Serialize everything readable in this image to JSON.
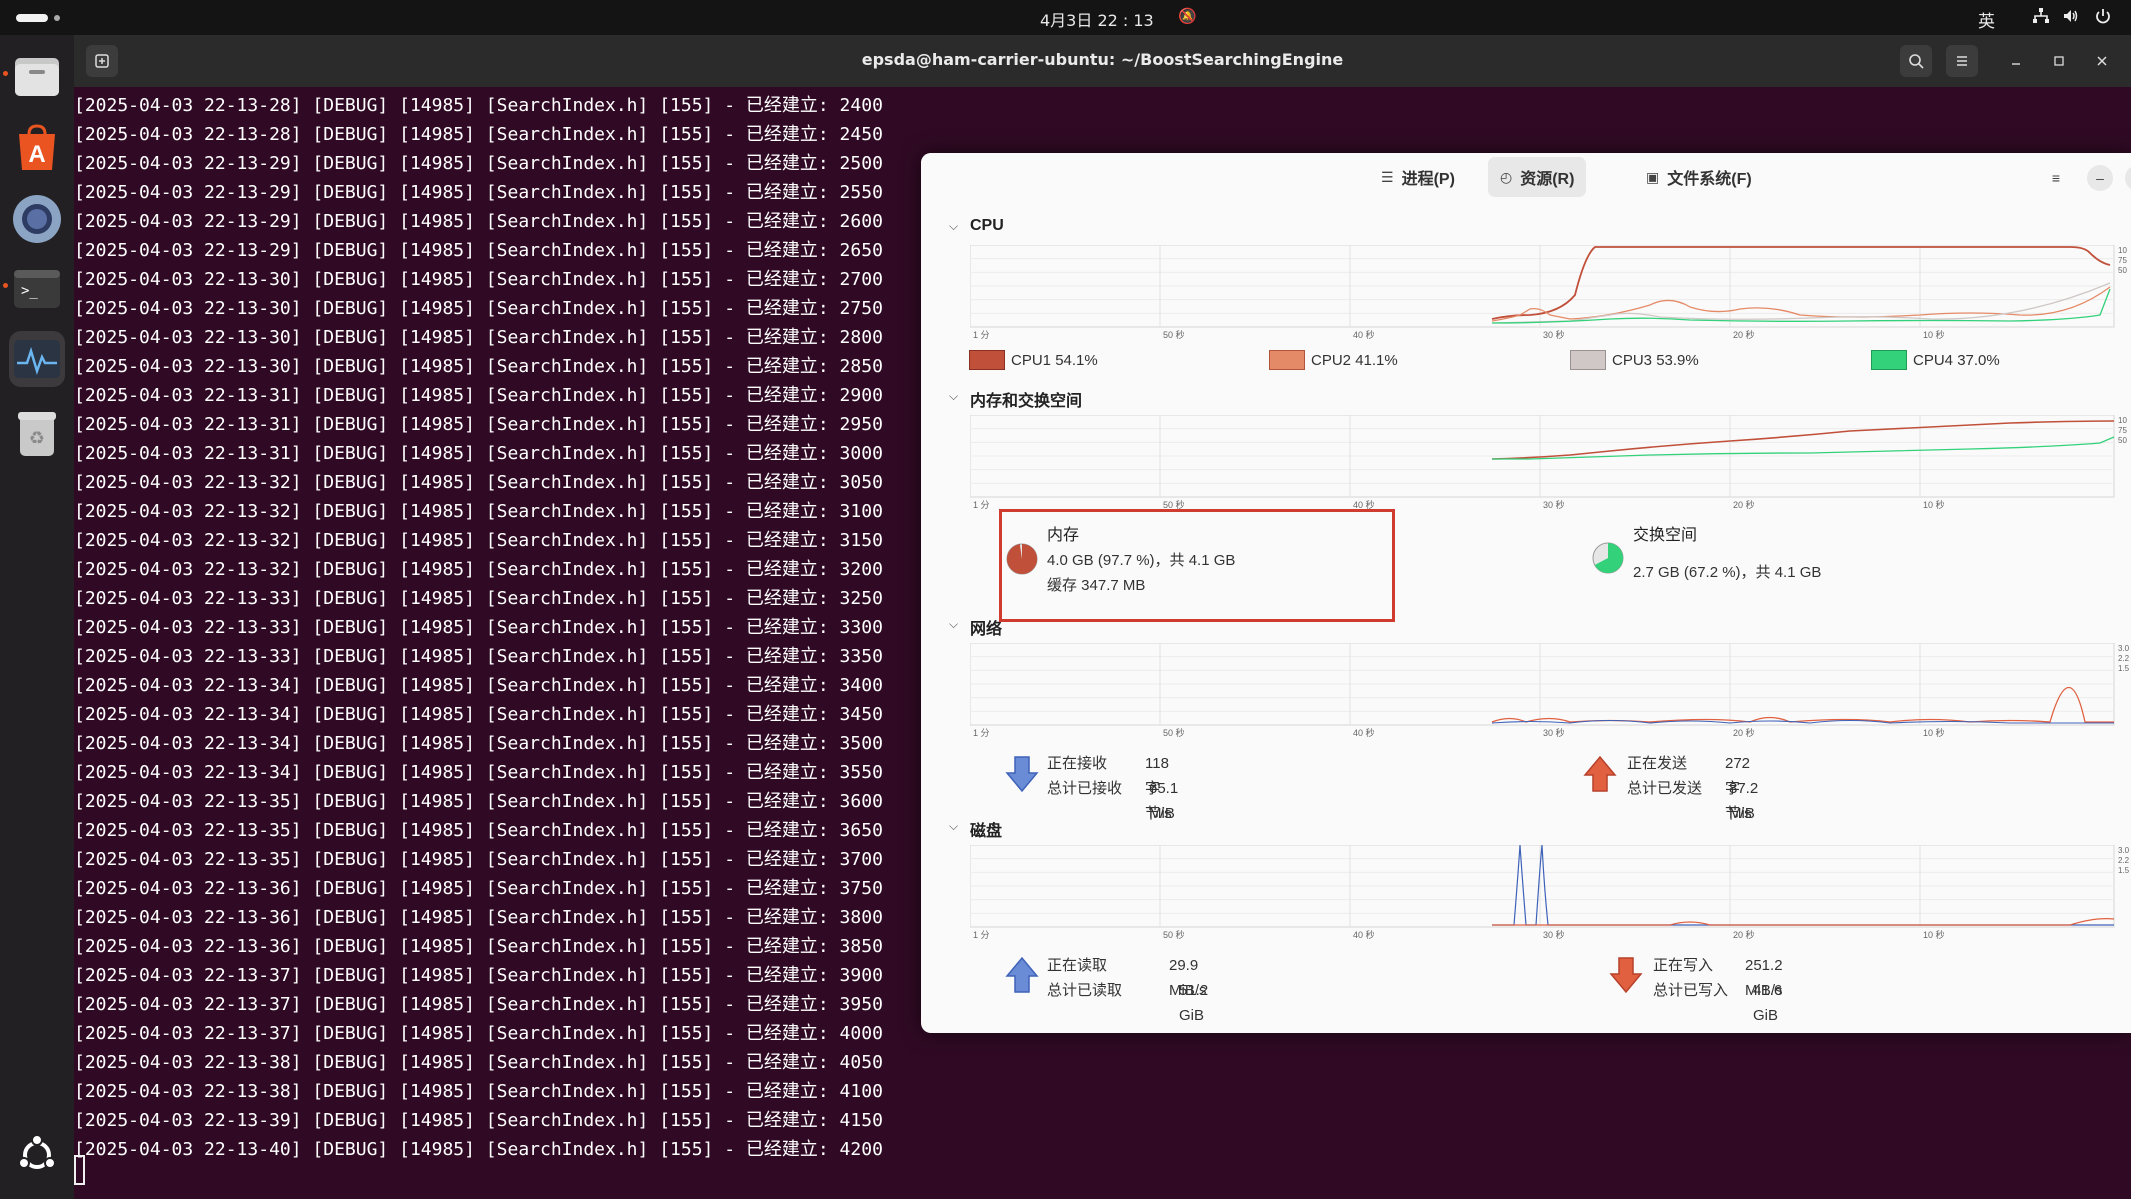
{
  "topbar": {
    "clock": "4月3日  22 : 13",
    "ime": "英"
  },
  "dock": {
    "items": [
      {
        "name": "files-icon"
      },
      {
        "name": "app-center-icon"
      },
      {
        "name": "chromium-icon"
      },
      {
        "name": "terminal-icon"
      },
      {
        "name": "system-monitor-icon"
      },
      {
        "name": "trash-icon"
      }
    ],
    "apps_icon": "ubuntu-apps-icon"
  },
  "terminal": {
    "title": "epsda@ham-carrier-ubuntu: ~/BoostSearchingEngine",
    "lines": [
      "[2025-04-03 22-13-28] [DEBUG] [14985] [SearchIndex.h] [155] - 已经建立: 2400",
      "[2025-04-03 22-13-28] [DEBUG] [14985] [SearchIndex.h] [155] - 已经建立: 2450",
      "[2025-04-03 22-13-29] [DEBUG] [14985] [SearchIndex.h] [155] - 已经建立: 2500",
      "[2025-04-03 22-13-29] [DEBUG] [14985] [SearchIndex.h] [155] - 已经建立: 2550",
      "[2025-04-03 22-13-29] [DEBUG] [14985] [SearchIndex.h] [155] - 已经建立: 2600",
      "[2025-04-03 22-13-29] [DEBUG] [14985] [SearchIndex.h] [155] - 已经建立: 2650",
      "[2025-04-03 22-13-30] [DEBUG] [14985] [SearchIndex.h] [155] - 已经建立: 2700",
      "[2025-04-03 22-13-30] [DEBUG] [14985] [SearchIndex.h] [155] - 已经建立: 2750",
      "[2025-04-03 22-13-30] [DEBUG] [14985] [SearchIndex.h] [155] - 已经建立: 2800",
      "[2025-04-03 22-13-30] [DEBUG] [14985] [SearchIndex.h] [155] - 已经建立: 2850",
      "[2025-04-03 22-13-31] [DEBUG] [14985] [SearchIndex.h] [155] - 已经建立: 2900",
      "[2025-04-03 22-13-31] [DEBUG] [14985] [SearchIndex.h] [155] - 已经建立: 2950",
      "[2025-04-03 22-13-31] [DEBUG] [14985] [SearchIndex.h] [155] - 已经建立: 3000",
      "[2025-04-03 22-13-32] [DEBUG] [14985] [SearchIndex.h] [155] - 已经建立: 3050",
      "[2025-04-03 22-13-32] [DEBUG] [14985] [SearchIndex.h] [155] - 已经建立: 3100",
      "[2025-04-03 22-13-32] [DEBUG] [14985] [SearchIndex.h] [155] - 已经建立: 3150",
      "[2025-04-03 22-13-32] [DEBUG] [14985] [SearchIndex.h] [155] - 已经建立: 3200",
      "[2025-04-03 22-13-33] [DEBUG] [14985] [SearchIndex.h] [155] - 已经建立: 3250",
      "[2025-04-03 22-13-33] [DEBUG] [14985] [SearchIndex.h] [155] - 已经建立: 3300",
      "[2025-04-03 22-13-33] [DEBUG] [14985] [SearchIndex.h] [155] - 已经建立: 3350",
      "[2025-04-03 22-13-34] [DEBUG] [14985] [SearchIndex.h] [155] - 已经建立: 3400",
      "[2025-04-03 22-13-34] [DEBUG] [14985] [SearchIndex.h] [155] - 已经建立: 3450",
      "[2025-04-03 22-13-34] [DEBUG] [14985] [SearchIndex.h] [155] - 已经建立: 3500",
      "[2025-04-03 22-13-34] [DEBUG] [14985] [SearchIndex.h] [155] - 已经建立: 3550",
      "[2025-04-03 22-13-35] [DEBUG] [14985] [SearchIndex.h] [155] - 已经建立: 3600",
      "[2025-04-03 22-13-35] [DEBUG] [14985] [SearchIndex.h] [155] - 已经建立: 3650",
      "[2025-04-03 22-13-35] [DEBUG] [14985] [SearchIndex.h] [155] - 已经建立: 3700",
      "[2025-04-03 22-13-36] [DEBUG] [14985] [SearchIndex.h] [155] - 已经建立: 3750",
      "[2025-04-03 22-13-36] [DEBUG] [14985] [SearchIndex.h] [155] - 已经建立: 3800",
      "[2025-04-03 22-13-36] [DEBUG] [14985] [SearchIndex.h] [155] - 已经建立: 3850",
      "[2025-04-03 22-13-37] [DEBUG] [14985] [SearchIndex.h] [155] - 已经建立: 3900",
      "[2025-04-03 22-13-37] [DEBUG] [14985] [SearchIndex.h] [155] - 已经建立: 3950",
      "[2025-04-03 22-13-37] [DEBUG] [14985] [SearchIndex.h] [155] - 已经建立: 4000",
      "[2025-04-03 22-13-38] [DEBUG] [14985] [SearchIndex.h] [155] - 已经建立: 4050",
      "[2025-04-03 22-13-38] [DEBUG] [14985] [SearchIndex.h] [155] - 已经建立: 4100",
      "[2025-04-03 22-13-39] [DEBUG] [14985] [SearchIndex.h] [155] - 已经建立: 4150",
      "[2025-04-03 22-13-40] [DEBUG] [14985] [SearchIndex.h] [155] - 已经建立: 4200"
    ],
    "colors": {
      "background": "#300a24",
      "text": "#ffffff"
    }
  },
  "monitor": {
    "tabs": [
      {
        "label": "进程(P)",
        "icon": "list-icon"
      },
      {
        "label": "资源(R)",
        "icon": "gauge-icon",
        "selected": true
      },
      {
        "label": "文件系统(F)",
        "icon": "drive-icon"
      }
    ],
    "x_ticks": [
      "1 分",
      "50 秒",
      "40 秒",
      "30 秒",
      "20 秒",
      "10 秒"
    ],
    "cpu": {
      "title": "CPU",
      "right_ticks": [
        "10",
        "75",
        "50"
      ],
      "legend": [
        {
          "label": "CPU1",
          "value": "54.1%",
          "color": "#c0503a"
        },
        {
          "label": "CPU2",
          "value": "41.1%",
          "color": "#e58a66"
        },
        {
          "label": "CPU3",
          "value": "53.9%",
          "color": "#cfc8c6"
        },
        {
          "label": "CPU4",
          "value": "37.0%",
          "color": "#33d17a"
        }
      ]
    },
    "memory": {
      "title": "内存和交换空间",
      "right_ticks": [
        "10",
        "75",
        "50"
      ],
      "mem": {
        "label": "内存",
        "usage": "4.0 GB (97.7 %)，共 4.1 GB",
        "cache": "缓存 347.7 MB",
        "fraction": 0.977,
        "color": "#c0503a"
      },
      "swap": {
        "label": "交换空间",
        "usage": "2.7 GB (67.2 %)，共 4.1 GB",
        "fraction": 0.672,
        "color": "#33d17a"
      }
    },
    "network": {
      "title": "网络",
      "right_ticks": [
        "3.0",
        "2.2",
        "1.5"
      ],
      "recv_label": "正在接收",
      "recv_value": "118 字节/s",
      "recv_total_label": "总计已接收",
      "recv_total": "65.1 MiB",
      "send_label": "正在发送",
      "send_value": "272 字节/s",
      "send_total_label": "总计已发送",
      "send_total": "87.2 MiB"
    },
    "disk": {
      "title": "磁盘",
      "right_ticks": [
        "3.0",
        "2.2",
        "1.5"
      ],
      "read_label": "正在读取",
      "read_value": "29.9 MiB/s",
      "read_total_label": "总计已读取",
      "read_total": "51.2 GiB",
      "write_label": "正在写入",
      "write_value": "251.2 MiB/s",
      "write_total_label": "总计已写入",
      "write_total": "41.6 GiB"
    }
  }
}
